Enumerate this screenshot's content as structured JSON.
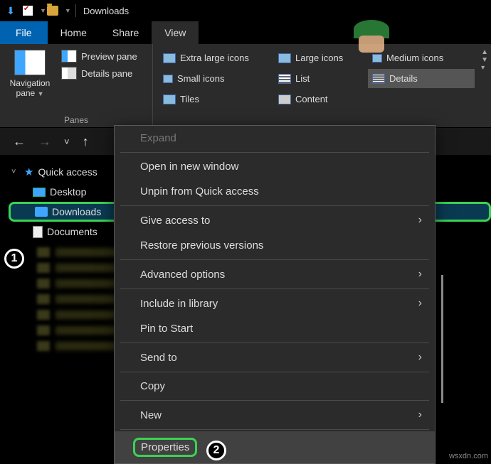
{
  "window": {
    "title": "Downloads"
  },
  "tabs": {
    "file": "File",
    "home": "Home",
    "share": "Share",
    "view": "View"
  },
  "ribbon": {
    "panes": {
      "navigation": "Navigation pane",
      "preview": "Preview pane",
      "details": "Details pane",
      "group_label": "Panes"
    },
    "layout": {
      "extra_large": "Extra large icons",
      "large": "Large icons",
      "medium": "Medium icons",
      "small": "Small icons",
      "list": "List",
      "details": "Details",
      "tiles": "Tiles",
      "content": "Content"
    }
  },
  "navtree": {
    "quick_access": "Quick access",
    "desktop": "Desktop",
    "downloads": "Downloads",
    "documents": "Documents"
  },
  "context_menu": {
    "expand": "Expand",
    "open_new": "Open in new window",
    "unpin": "Unpin from Quick access",
    "give_access": "Give access to",
    "restore": "Restore previous versions",
    "advanced": "Advanced options",
    "include": "Include in library",
    "pin_start": "Pin to Start",
    "send_to": "Send to",
    "copy": "Copy",
    "new": "New",
    "properties": "Properties"
  },
  "annotations": {
    "one": "1",
    "two": "2"
  },
  "watermark": "wsxdn.com"
}
